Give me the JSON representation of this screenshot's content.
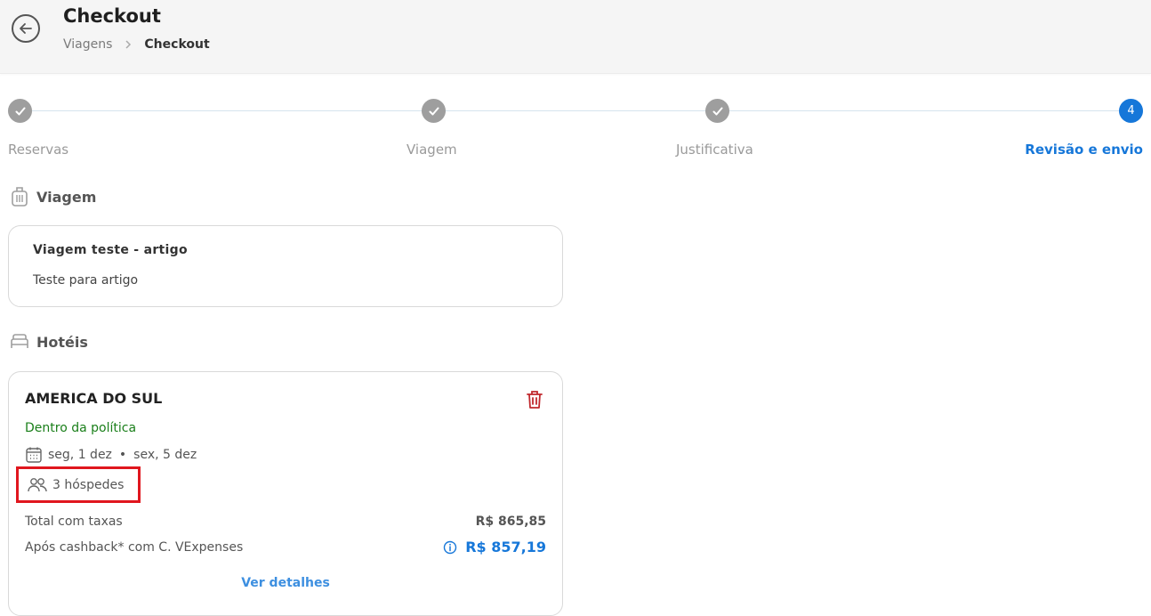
{
  "header": {
    "title": "Checkout",
    "breadcrumb": [
      "Viagens",
      "Checkout"
    ]
  },
  "steps": [
    {
      "label": "Reservas",
      "status": "done"
    },
    {
      "label": "Viagem",
      "status": "done"
    },
    {
      "label": "Justificativa",
      "status": "done"
    },
    {
      "label": "Revisão e envio",
      "number": "4",
      "status": "active"
    }
  ],
  "trip_section": {
    "title": "Viagem",
    "name": "Viagem teste - artigo",
    "description": "Teste para artigo"
  },
  "hotels_section": {
    "title": "Hotéis",
    "hotel": {
      "name": "AMERICA DO SUL",
      "policy": "Dentro da política",
      "checkin": "seg, 1 dez",
      "checkout": "sex, 5 dez",
      "guests": "3 hóspedes",
      "total_label": "Total com taxas",
      "total_value": "R$ 865,85",
      "cashback_label": "Após cashback* com C. VExpenses",
      "cashback_value": "R$ 857,19",
      "details_link": "Ver detalhes"
    }
  },
  "colors": {
    "accent": "#1677d9",
    "policy_ok": "#1a7f1a",
    "delete": "#c0282d",
    "highlight_box": "#e0161e"
  }
}
